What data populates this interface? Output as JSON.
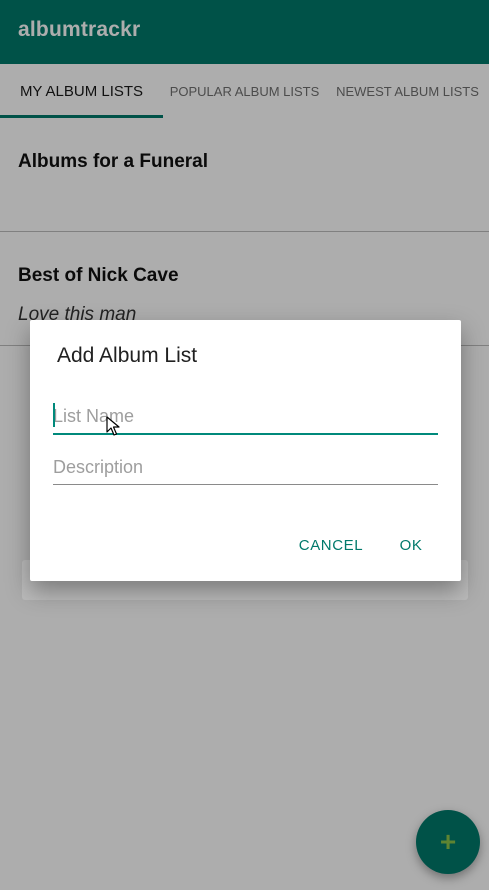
{
  "app": {
    "title": "albumtrackr"
  },
  "tabs": [
    {
      "label": "MY ALBUM LISTS",
      "active": true
    },
    {
      "label": "POPULAR ALBUM LISTS",
      "active": false
    },
    {
      "label": "NEWEST ALBUM LISTS",
      "active": false
    }
  ],
  "lists": [
    {
      "name": "Albums for a Funeral",
      "description": ""
    },
    {
      "name": "Best of Nick Cave",
      "description": "Love this man"
    }
  ],
  "dialog": {
    "title": "Add Album List",
    "name_placeholder": "List Name",
    "name_value": "",
    "description_placeholder": "Description",
    "description_value": "",
    "cancel_label": "CANCEL",
    "ok_label": "OK"
  },
  "fab": {
    "icon": "plus-icon",
    "glyph": "+"
  },
  "colors": {
    "primary": "#00796b",
    "accent": "#8bc34a"
  }
}
